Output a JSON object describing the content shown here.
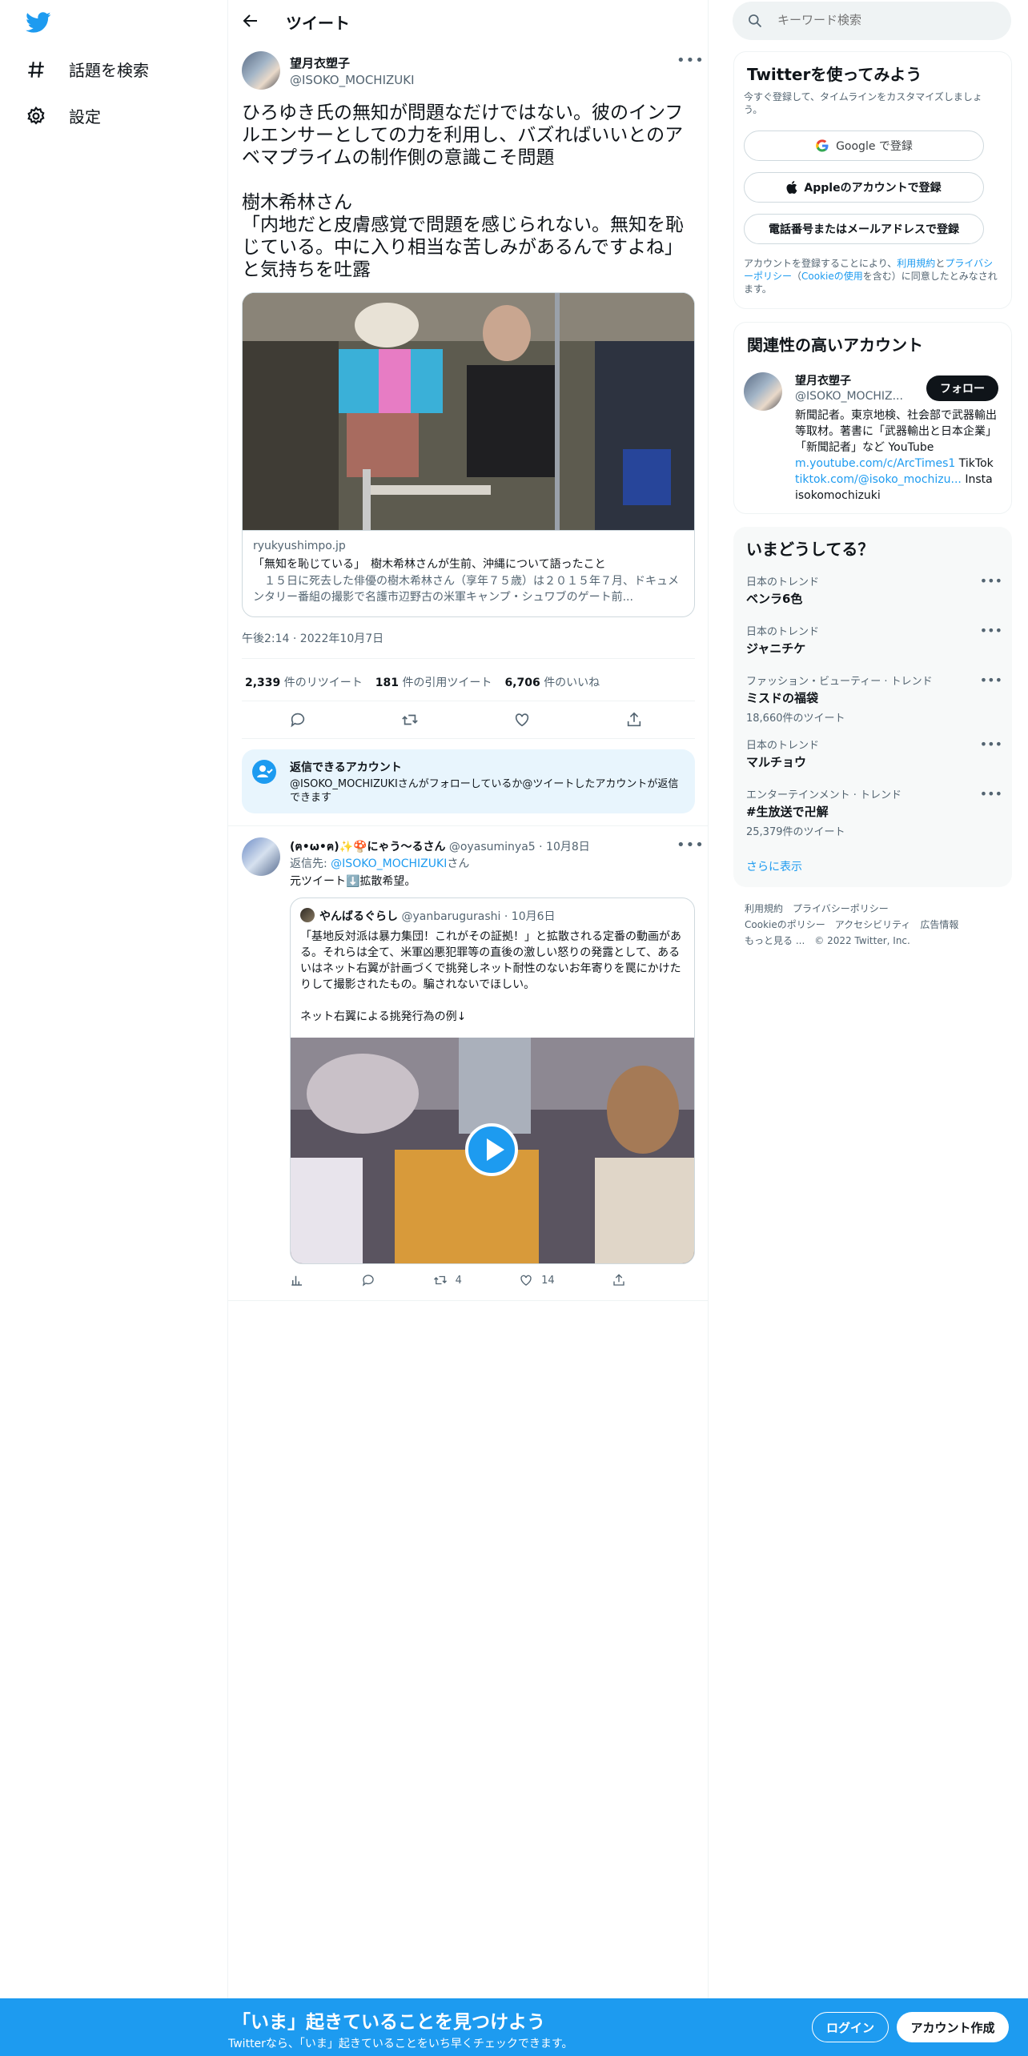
{
  "nav": {
    "explore": "話題を検索",
    "settings": "設定"
  },
  "header": {
    "title": "ツイート"
  },
  "tweet": {
    "author_name": "望月衣塑子",
    "author_handle": "@ISOKO_MOCHIZUKI",
    "text": "ひろゆき氏の無知が問題なだけではない。彼のインフルエンサーとしての力を利用し、バズればいいとのアベマプライムの制作側の意識こそ問題\n\n樹木希林さん\n「内地だと皮膚感覚で問題を感じられない。無知を恥じている。中に入り相当な苦しみがあるんですよね」と気持ちを吐露",
    "card": {
      "domain": "ryukyushimpo.jp",
      "title": "「無知を恥じている」　樹木希林さんが生前、沖縄について語ったこと",
      "description": "　１５日に死去した俳優の樹木希林さん（享年７５歳）は２０１５年７月、ドキュメンタリー番組の撮影で名護市辺野古の米軍キャンプ・シュワブのゲート前..."
    },
    "timestamp": "午後2:14 · 2022年10月7日",
    "stats": [
      {
        "value": "2,339",
        "label": "件のリツイート"
      },
      {
        "value": "181",
        "label": "件の引用ツイート"
      },
      {
        "value": "6,706",
        "label": "件のいいね"
      }
    ]
  },
  "reply_restriction": {
    "title": "返信できるアカウント",
    "text": "@ISOKO_MOCHIZUKIさんがフォローしているか@ツイートしたアカウントが返信できます"
  },
  "reply": {
    "author_name": "(ฅ•ω•ฅ)✨🍄にゃう〜るさん",
    "author_handle": "@oyasuminya5",
    "date": "· 10月8日",
    "replying_label": "返信先:",
    "replying_handle": "@ISOKO_MOCHIZUKI",
    "replying_suffix": "さん",
    "text": "元ツイート⬇️拡散希望。",
    "quote": {
      "author_name": "やんばるぐらし",
      "author_handle": "@yanbarugurashi",
      "date": "· 10月6日",
      "text": "「基地反対派は暴力集団！これがその証拠！」と拡散される定番の動画がある。それらは全て、米軍凶悪犯罪等の直後の激しい怒りの発露として、あるいはネット右翼が計画づくで挑発しネット耐性のないお年寄りを罠にかけたりして撮影されたもの。騙されないでほしい。\n\nネット右翼による挑発行為の例↓"
    },
    "retweets": "4",
    "likes": "14"
  },
  "search": {
    "placeholder": "キーワード検索"
  },
  "signup": {
    "title": "Twitterを使ってみよう",
    "subtitle": "今すぐ登録して、タイムラインをカスタマイズしましょう。",
    "google": "Google で登録",
    "apple": "Appleのアカウントで登録",
    "phone": "電話番号またはメールアドレスで登録",
    "legal_prefix": "アカウントを登録することにより、",
    "legal_terms": "利用規約",
    "legal_and": "と",
    "legal_privacy": "プライバシーポリシー",
    "legal_cookie_open": "（",
    "legal_cookie": "Cookieの使用",
    "legal_suffix": "を含む）に同意したとみなされます。"
  },
  "related": {
    "title": "関連性の高いアカウント",
    "name": "望月衣塑子",
    "handle": "@ISOKO_MOCHIZ...",
    "follow": "フォロー",
    "bio1": "新聞記者。東京地検、社会部で武器輸出等取材。著書に「武器輸出と日本企業」「新聞記者」など YouTube",
    "link1": "m.youtube.com/c/ArcTimes1",
    "bio2": " TikTok",
    "link2": "tiktok.com/@isoko_mochizu...",
    "bio3": " Insta isokomochizuki"
  },
  "trends": {
    "title": "いまどうしてる？",
    "items": [
      {
        "category": "日本のトレンド",
        "name": "ベンラ6色",
        "count": ""
      },
      {
        "category": "日本のトレンド",
        "name": "ジャニチケ",
        "count": ""
      },
      {
        "category": "ファッション・ビューティー · トレンド",
        "name": "ミスドの福袋",
        "count": "18,660件のツイート"
      },
      {
        "category": "日本のトレンド",
        "name": "マルチョウ",
        "count": ""
      },
      {
        "category": "エンターテインメント · トレンド",
        "name": "#生放送で卍解",
        "count": "25,379件のツイート"
      }
    ],
    "more": "さらに表示"
  },
  "footer_links": {
    "line1": "利用規約　プライバシーポリシー",
    "line2": "Cookieのポリシー　アクセシビリティ　広告情報",
    "line3": "もっと見る ...　© 2022 Twitter, Inc."
  },
  "bottom_bar": {
    "title": "「いま」起きていることを見つけよう",
    "subtitle": "Twitterなら、「いま」起きていることをいち早くチェックできます。",
    "login": "ログイン",
    "signup": "アカウント作成"
  },
  "colors": {
    "accent": "#1d9bf0",
    "text": "#0f1419",
    "muted": "#536471",
    "border": "#eff3f4"
  }
}
